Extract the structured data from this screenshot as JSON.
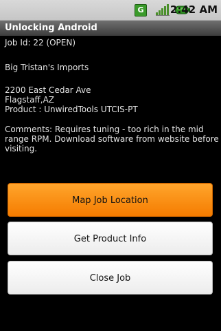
{
  "status_bar": {
    "g_icon_label": "G",
    "time": "2:42 AM",
    "icons": [
      "g-notification-icon",
      "signal-icon",
      "battery-icon"
    ]
  },
  "app": {
    "title": "Unlocking Android"
  },
  "job": {
    "job_id": "Job Id: 22 (OPEN)",
    "customer": "Big Tristan's Imports",
    "address_line1": "2200 East Cedar Ave",
    "address_line2": "Flagstaff,AZ",
    "product": "Product : UnwiredTools UTCIS-PT",
    "comments": "Comments: Requires tuning - too rich in the mid range RPM.  Download software from website before visiting."
  },
  "buttons": {
    "map_label": "Map Job Location",
    "product_label": "Get Product Info",
    "close_label": "Close Job"
  },
  "colors": {
    "accent_orange": "#f57c00",
    "title_bar": "#4a4a4a",
    "status_green": "#3a9a2a"
  }
}
